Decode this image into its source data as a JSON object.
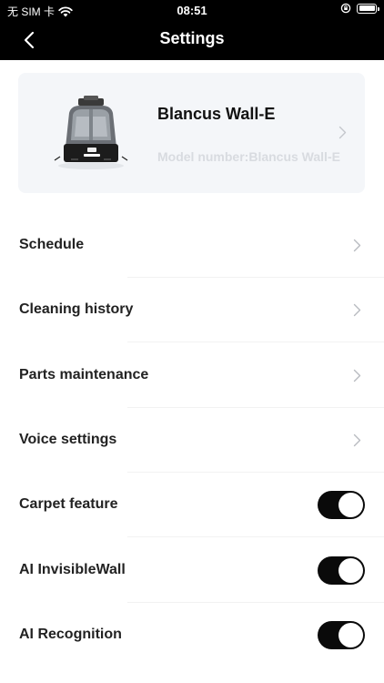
{
  "status_bar": {
    "carrier": "无 SIM 卡",
    "time": "08:51"
  },
  "nav": {
    "title": "Settings"
  },
  "device": {
    "name": "Blancus Wall-E",
    "model": "Model number:Blancus Wall-E"
  },
  "menu": {
    "schedule": "Schedule",
    "cleaning_history": "Cleaning history",
    "parts_maintenance": "Parts maintenance",
    "voice_settings": "Voice settings"
  },
  "toggles": {
    "carpet": {
      "label": "Carpet feature",
      "on": true
    },
    "invisible_wall": {
      "label": "AI InvisibleWall",
      "on": true
    },
    "recognition": {
      "label": "AI Recognition",
      "on": true
    }
  },
  "colors": {
    "header_bg": "#000000",
    "card_bg": "#f4f6f9",
    "toggle_on": "#0a0a0a",
    "model_text": "#d8dbe0"
  }
}
